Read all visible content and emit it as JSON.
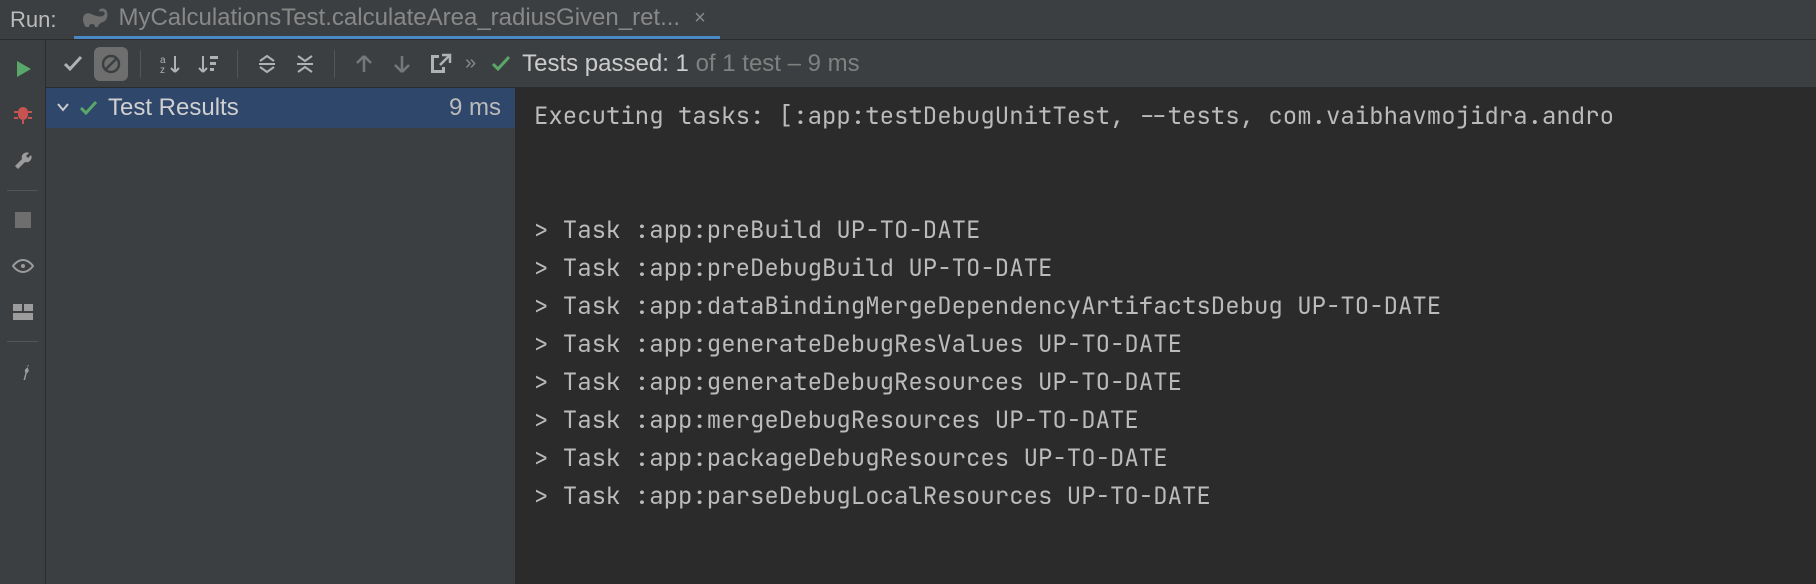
{
  "header": {
    "run_label": "Run:",
    "tab_title": "MyCalculationsTest.calculateArea_radiusGiven_ret...",
    "tab_close": "×"
  },
  "toolbar": {
    "status_prefix": "Tests passed:",
    "status_passed": "1",
    "status_suffix_of": " of 1 test – 9 ms",
    "chevrons": "»"
  },
  "tree": {
    "root_label": "Test Results",
    "root_time": "9 ms"
  },
  "console": {
    "lines": [
      "Executing tasks: [:app:testDebugUnitTest, --tests, com.vaibhavmojidra.andro",
      "",
      "",
      "> Task :app:preBuild UP-TO-DATE",
      "> Task :app:preDebugBuild UP-TO-DATE",
      "> Task :app:dataBindingMergeDependencyArtifactsDebug UP-TO-DATE",
      "> Task :app:generateDebugResValues UP-TO-DATE",
      "> Task :app:generateDebugResources UP-TO-DATE",
      "> Task :app:mergeDebugResources UP-TO-DATE",
      "> Task :app:packageDebugResources UP-TO-DATE",
      "> Task :app:parseDebugLocalResources UP-TO-DATE"
    ]
  },
  "icons": {
    "run": "run-icon",
    "debug": "debug-icon",
    "wrench": "wrench-icon",
    "stop": "stop-icon",
    "visibility": "visibility-icon",
    "layout": "layout-icon",
    "pin": "pin-icon",
    "check": "check-icon",
    "block": "block-icon",
    "sort_alpha": "sort-alpha-icon",
    "sort_time": "sort-time-icon",
    "expand_all": "expand-all-icon",
    "collapse_all": "collapse-all-icon",
    "arrow_up": "arrow-up-icon",
    "arrow_down": "arrow-down-icon",
    "export": "export-icon",
    "gradle": "gradle-icon"
  }
}
